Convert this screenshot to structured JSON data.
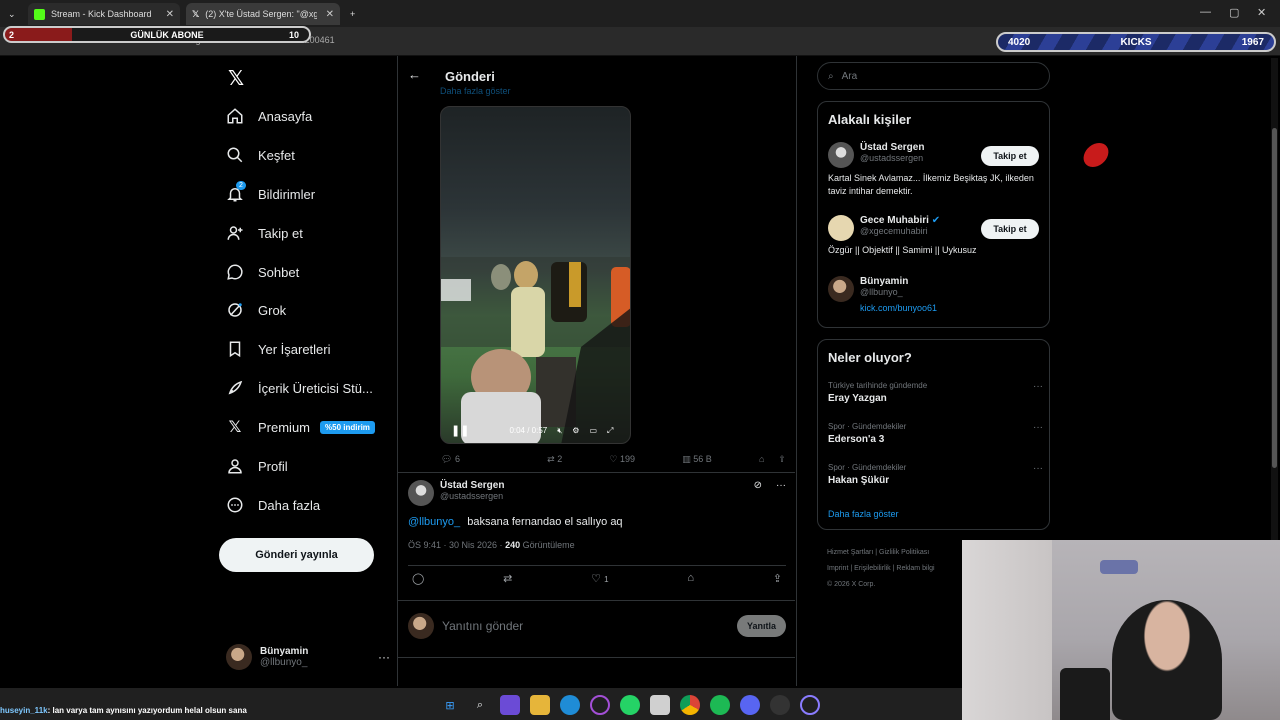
{
  "browser": {
    "tabs": [
      {
        "label": "Stream - Kick Dashboard",
        "icon": "kick-icon"
      },
      {
        "label": "(2) X'te Üstad Sergen: \"@xgece...",
        "icon": "x-icon"
      }
    ],
    "new_tab": "+",
    "url": "x.com/ustadssergen/status/2049922313734200461"
  },
  "overlay": {
    "left_count": "2",
    "left_label": "GÜNLÜK ABONE",
    "left_goal": "10",
    "right_left": "4020",
    "right_label": "KICKS",
    "right_right": "1967"
  },
  "nav": {
    "items": [
      {
        "label": "Anasayfa",
        "icon": "home-icon"
      },
      {
        "label": "Keşfet",
        "icon": "search-icon"
      },
      {
        "label": "Bildirimler",
        "icon": "bell-icon",
        "badge": "2"
      },
      {
        "label": "Takip et",
        "icon": "person-add-icon"
      },
      {
        "label": "Sohbet",
        "icon": "chat-icon"
      },
      {
        "label": "Grok",
        "icon": "grok-icon"
      },
      {
        "label": "Yer İşaretleri",
        "icon": "bookmark-icon"
      },
      {
        "label": "İçerik Üreticisi Stü...",
        "icon": "rocket-icon"
      },
      {
        "label": "Premium",
        "icon": "x-icon",
        "badge": "%50 indirim"
      },
      {
        "label": "Profil",
        "icon": "profile-icon"
      },
      {
        "label": "Daha fazla",
        "icon": "more-circle-icon"
      }
    ],
    "post_button": "Gönderi yayınla",
    "me": {
      "name": "Bünyamin",
      "handle": "@llbunyo_"
    }
  },
  "main": {
    "header": "Gönderi",
    "show_more": "Daha fazla göster",
    "video": {
      "time": "0:04 / 0:57"
    },
    "stats": {
      "replies": "6",
      "reposts": "2",
      "likes": "199",
      "views": "56 B"
    },
    "reply": {
      "name": "Üstad Sergen",
      "handle": "@ustadssergen",
      "mention": "@llbunyo_",
      "text": "baksana fernandao el sallıyo aq",
      "time": "ÖS 9:41 · 30 Nis 2026 ·",
      "views_count": "240",
      "views_label": "Görüntüleme",
      "likes": "1"
    },
    "compose": {
      "placeholder": "Yanıtını gönder",
      "button": "Yanıtla"
    }
  },
  "right": {
    "search_placeholder": "Ara",
    "people_title": "Alakalı kişiler",
    "people": [
      {
        "name": "Üstad Sergen",
        "handle": "@ustadssergen",
        "bio": "Kartal Sinek Avlamaz... İlkemiz Beşiktaş JK, ilkeden taviz intihar demektir.",
        "button": "Takip et"
      },
      {
        "name": "Gece Muhabiri",
        "handle": "@xgecemuhabiri",
        "bio": "Özgür || Objektif || Samimi || Uykusuz",
        "button": "Takip et",
        "verified": true
      },
      {
        "name": "Bünyamin",
        "handle": "@llbunyo_",
        "bio": "kick.com/bunyoo61"
      }
    ],
    "trends_title": "Neler oluyor?",
    "trends": [
      {
        "context": "Türkiye tarihinde gündemde",
        "title": "Eray Yazgan"
      },
      {
        "context": "Spor · Gündemdekiler",
        "title": "Ederson'a 3"
      },
      {
        "context": "Spor · Gündemdekiler",
        "title": "Hakan Şükür"
      }
    ],
    "trends_more": "Daha fazla göster",
    "footer": [
      "Hizmet Şartları",
      "Gizlilik Politikası",
      "Imprint",
      "Erişilebilirlik",
      "Reklam bilgi",
      "© 2026 X Corp."
    ]
  },
  "chat": {
    "user": "huseyin_11k",
    "text": ": lan varya tam aynısını yazıyordum helal olsun sana"
  },
  "colors": {
    "accent": "#1d9bf0",
    "bg": "#000000",
    "kick": "#53fc18"
  }
}
